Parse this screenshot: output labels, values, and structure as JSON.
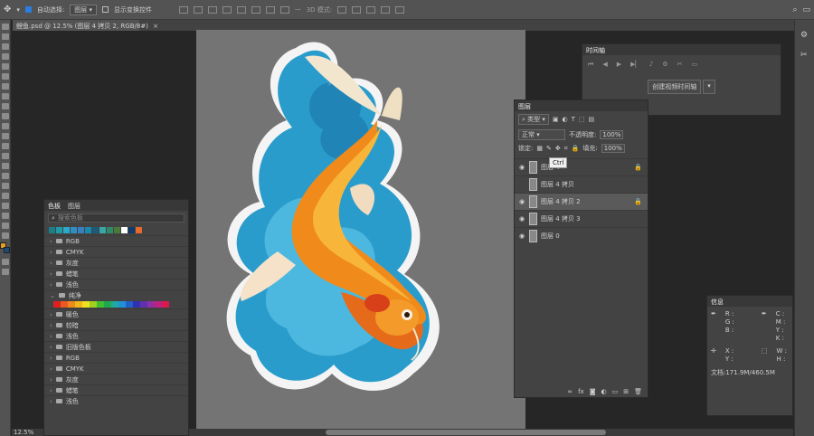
{
  "options_bar": {
    "auto_select_label": "自动选择:",
    "auto_select_value": "图层",
    "show_transform_label": "显示变换控件",
    "mode_3d_label": "3D 模式:"
  },
  "document_tab": {
    "title": "鲤鱼.psd @ 12.5% (图层 4 拷贝 2, RGB/8#)"
  },
  "status": {
    "zoom": "12.5%"
  },
  "swatches_panel": {
    "tabs": [
      "色板",
      "图层"
    ],
    "search_placeholder": "搜索色板",
    "recent_colors": [
      "#1a7f86",
      "#1f9aa8",
      "#2aa9c8",
      "#2f8fc2",
      "#3b7fc0",
      "#188ab0",
      "#1e5b7a",
      "#3aa6a6",
      "#2f8a6a",
      "#4a7a3a",
      "#ffffff",
      "#123a6a",
      "#e86a2a"
    ],
    "groups": [
      "RGB",
      "CMYK",
      "灰度",
      "蜡笔",
      "浅色"
    ],
    "open_group": "纯净",
    "pure_colors": [
      "#e02020",
      "#e85a20",
      "#f08a1a",
      "#f0b81a",
      "#f0e020",
      "#a0d020",
      "#40c030",
      "#20a850",
      "#20a8a0",
      "#2090d8",
      "#2060c8",
      "#3030b0",
      "#6030b0",
      "#9030a0",
      "#c02080",
      "#d81a50"
    ],
    "groups_after": [
      "暖色",
      "较暗",
      "浅色",
      "旧版色板",
      "RGB",
      "CMYK",
      "灰度",
      "蜡笔",
      "浅色"
    ]
  },
  "timeline_panel": {
    "title": "时间轴",
    "create_button": "创建视频时间轴"
  },
  "layers_panel": {
    "title": "图层",
    "filter_kind": "类型",
    "blend_mode": "正常",
    "opacity_label": "不透明度:",
    "opacity_value": "100%",
    "lock_label": "锁定:",
    "fill_label": "填充:",
    "fill_value": "100%",
    "tooltip": "Ctrl",
    "layers": [
      {
        "name": "图层 4",
        "visible": true,
        "locked": true,
        "selected": false
      },
      {
        "name": "图层 4 拷贝",
        "visible": false,
        "locked": false,
        "selected": false
      },
      {
        "name": "图层 4 拷贝 2",
        "visible": true,
        "locked": true,
        "selected": true
      },
      {
        "name": "图层 4 拷贝 3",
        "visible": true,
        "locked": false,
        "selected": false
      },
      {
        "name": "图层 0",
        "visible": true,
        "locked": false,
        "selected": false
      }
    ]
  },
  "info_panel": {
    "title": "信息",
    "r": "R :",
    "g": "G :",
    "b": "B :",
    "c": "C :",
    "m": "M :",
    "y": "Y :",
    "k": "K :",
    "x": "X :",
    "y2": "Y :",
    "w": "W :",
    "h": "H :",
    "doc_size": "文档:171.9M/460.5M"
  }
}
